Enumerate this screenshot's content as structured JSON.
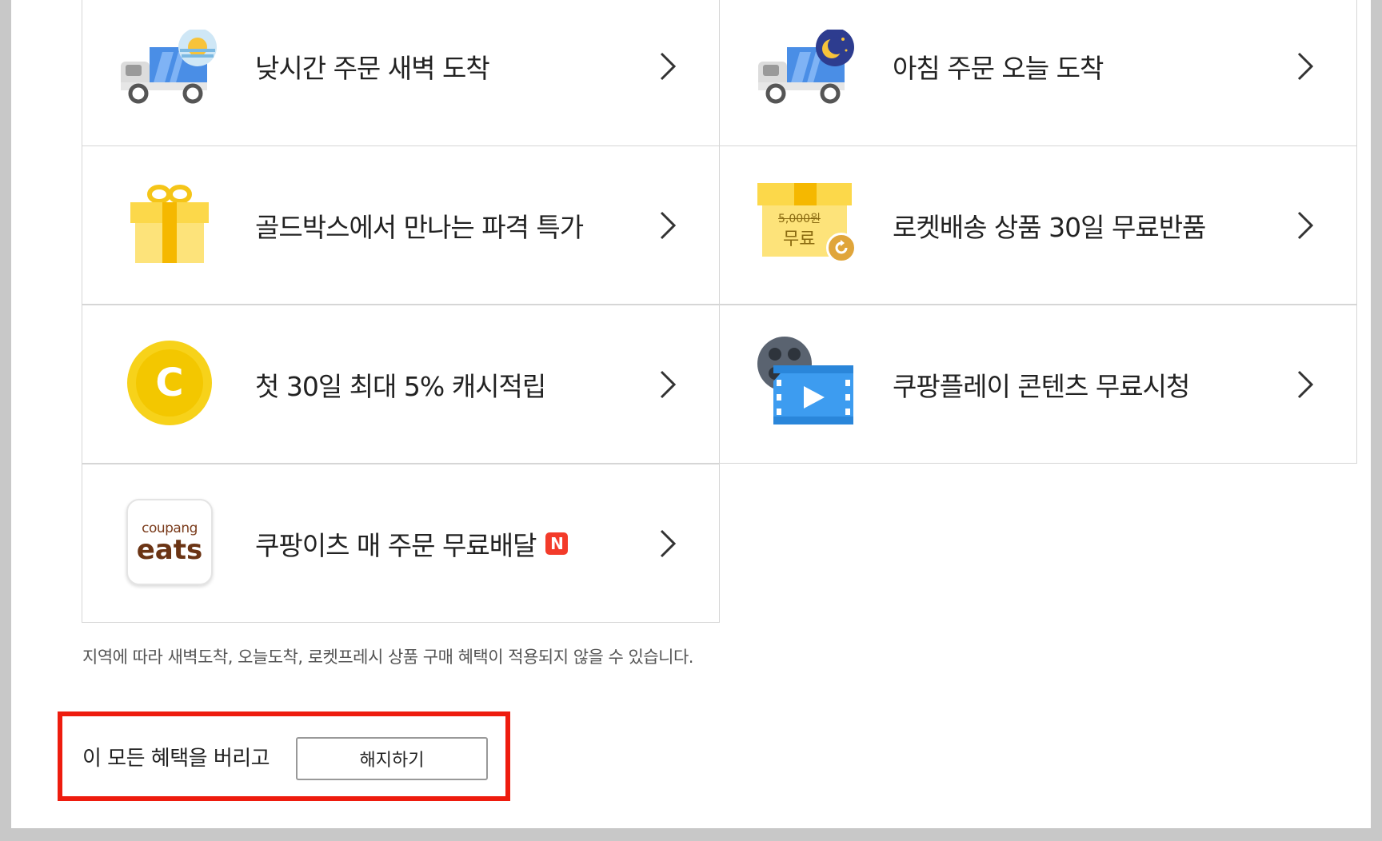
{
  "benefits": [
    {
      "label": "낮시간 주문 새벽 도착",
      "icon": "truck-sunrise-icon"
    },
    {
      "label": "아침 주문 오늘 도착",
      "icon": "truck-moon-icon"
    },
    {
      "label": "골드박스에서 만나는 파격 특가",
      "icon": "gift-box-icon"
    },
    {
      "label": "로켓배송 상품 30일 무료반품",
      "icon": "free-return-box-icon",
      "icon_price": "5,000원",
      "icon_free": "무료"
    },
    {
      "label": "첫 30일 최대 5% 캐시적립",
      "icon": "cash-coin-icon",
      "icon_letter": "C"
    },
    {
      "label": "쿠팡플레이 콘텐츠 무료시청",
      "icon": "video-play-icon"
    },
    {
      "label": "쿠팡이츠 매 주문 무료배달",
      "icon": "coupang-eats-icon",
      "icon_text_top": "coupang",
      "icon_text_bottom": "eats",
      "badge": "N"
    }
  ],
  "notice": "지역에 따라 새벽도착, 오늘도착, 로켓프레시 상품 구매 혜택이 적용되지 않을 수 있습니다.",
  "cancel": {
    "text": "이 모든 혜택을 버리고",
    "button_label": "해지하기"
  },
  "colors": {
    "highlight": "#ee1c0e",
    "coin": "#f7d21a",
    "badge": "#f33b2a",
    "border": "#d6d6d6"
  }
}
